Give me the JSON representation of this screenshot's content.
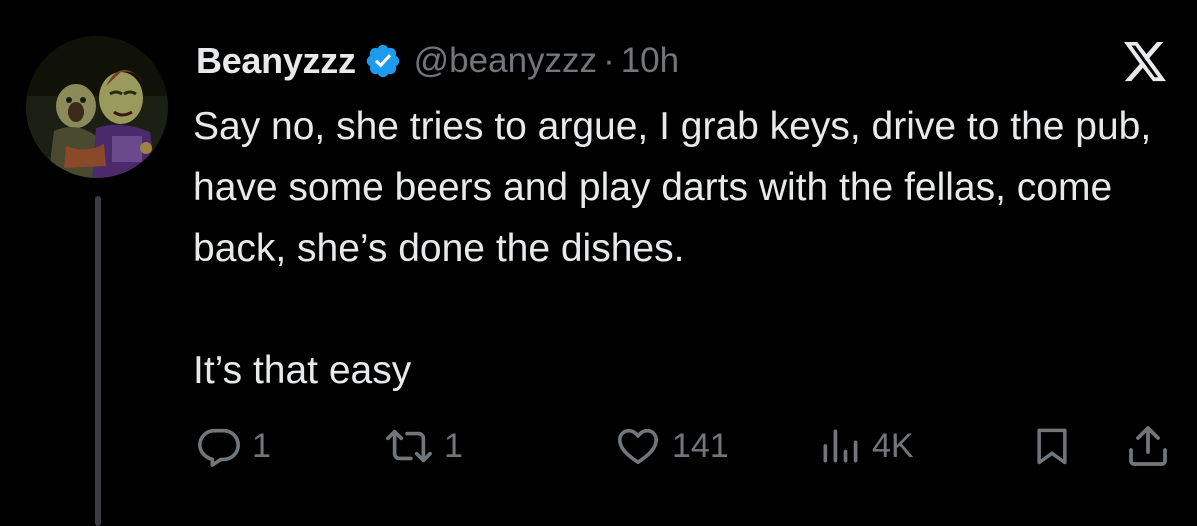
{
  "tweet": {
    "display_name": "Beanyzzz",
    "handle": "@beanyzzz",
    "separator": "·",
    "time": "10h",
    "text_paragraphs": [
      "Say no, she tries to argue, I grab keys, drive to the pub, have some beers and play darts with the fellas, come back, she’s done the dishes.",
      "It’s that easy"
    ]
  },
  "actions": {
    "reply_count": "1",
    "retweet_count": "1",
    "like_count": "141",
    "views_count": "4K"
  },
  "icons": {
    "verified": "verified-badge-icon",
    "logo": "x-logo-icon",
    "reply": "reply-icon",
    "retweet": "retweet-icon",
    "like": "heart-icon",
    "views": "views-chart-icon",
    "bookmark": "bookmark-icon",
    "share": "share-icon"
  },
  "colors": {
    "background": "#000000",
    "text": "#e7e9ea",
    "secondary_text": "#71767b",
    "verified_blue": "#1d9bf0",
    "thread_line": "#3a3d42"
  }
}
